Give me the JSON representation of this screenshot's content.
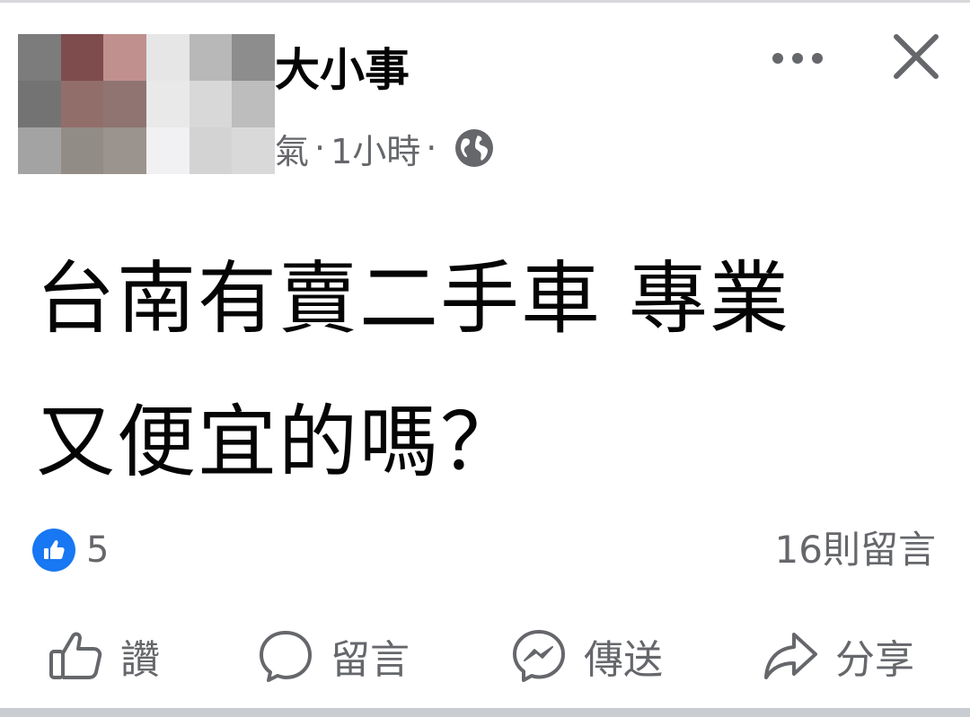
{
  "post": {
    "page_name": "大小事",
    "author_fragment": "氣",
    "time": "1小時",
    "dot": "·",
    "audience_icon": "globe-icon",
    "text_lines": [
      "台南有賣二手車 專業",
      "又便宜的嗎？"
    ]
  },
  "header_controls": {
    "more_icon": "more-dots-icon",
    "close_icon": "close-icon"
  },
  "stats": {
    "reaction_icon": "like-reaction-icon",
    "reaction_count": "5",
    "comments": "16則留言"
  },
  "actions": {
    "like": "讚",
    "comment": "留言",
    "send": "傳送",
    "share": "分享"
  },
  "colors": {
    "primary_text": "#050505",
    "secondary_text": "#65676b",
    "accent_blue": "#1877f2"
  }
}
